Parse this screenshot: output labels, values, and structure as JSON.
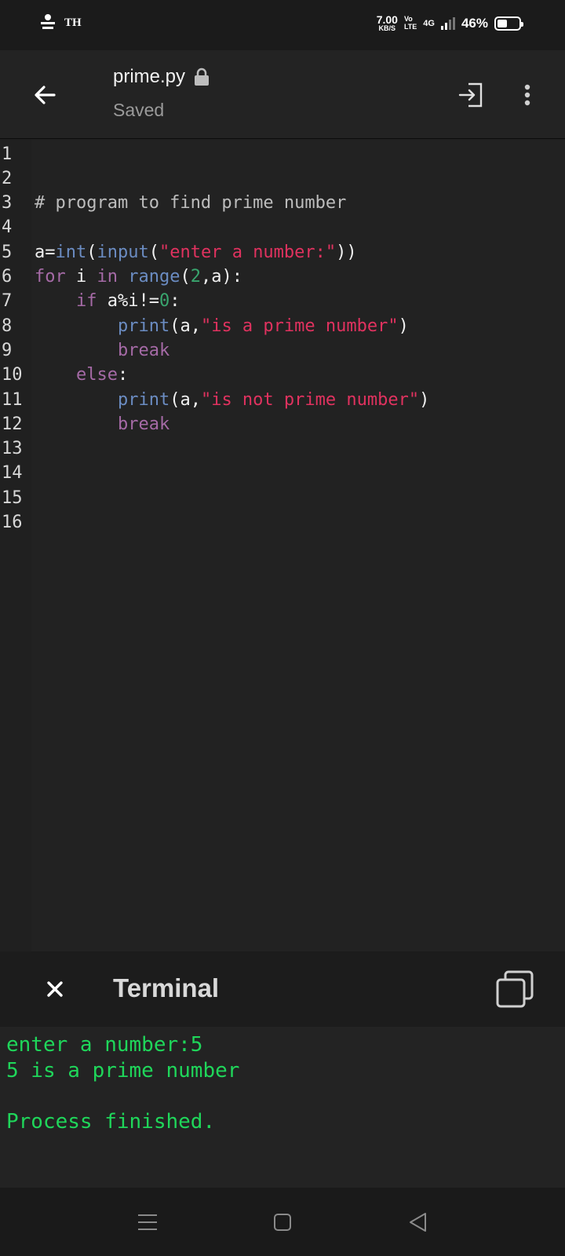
{
  "status_bar": {
    "carrier_text": "TH",
    "speed_value": "7.00",
    "speed_unit": "KB/S",
    "volte_top": "Vo",
    "volte_bottom": "LTE",
    "network": "4G",
    "battery_percent": "46%",
    "battery_level": 0.46
  },
  "app_bar": {
    "file_name": "prime.py",
    "file_status": "Saved",
    "icons": [
      "back-arrow-icon",
      "lock-icon",
      "run-icon",
      "more-vertical-icon"
    ]
  },
  "editor": {
    "line_numbers": [
      "1",
      "2",
      "3",
      "4",
      "5",
      "6",
      "7",
      "8",
      "9",
      "10",
      "11",
      "12",
      "13",
      "14",
      "15",
      "16"
    ],
    "lines": [
      [],
      [],
      [
        {
          "t": "# program to find prime number",
          "c": "comment"
        }
      ],
      [],
      [
        {
          "t": "a=",
          "c": "plain"
        },
        {
          "t": "int",
          "c": "fn"
        },
        {
          "t": "(",
          "c": "plain"
        },
        {
          "t": "input",
          "c": "fn"
        },
        {
          "t": "(",
          "c": "plain"
        },
        {
          "t": "\"enter a number:\"",
          "c": "str"
        },
        {
          "t": "))",
          "c": "plain"
        }
      ],
      [
        {
          "t": "for",
          "c": "kw"
        },
        {
          "t": " i ",
          "c": "plain"
        },
        {
          "t": "in",
          "c": "kw"
        },
        {
          "t": " ",
          "c": "plain"
        },
        {
          "t": "range",
          "c": "fn"
        },
        {
          "t": "(",
          "c": "plain"
        },
        {
          "t": "2",
          "c": "num"
        },
        {
          "t": ",a):",
          "c": "plain"
        }
      ],
      [
        {
          "t": "    ",
          "c": "plain"
        },
        {
          "t": "if",
          "c": "kw"
        },
        {
          "t": " a%i!=",
          "c": "plain"
        },
        {
          "t": "0",
          "c": "num"
        },
        {
          "t": ":",
          "c": "plain"
        }
      ],
      [
        {
          "t": "        ",
          "c": "plain"
        },
        {
          "t": "print",
          "c": "fn"
        },
        {
          "t": "(a,",
          "c": "plain"
        },
        {
          "t": "\"is a prime number\"",
          "c": "str"
        },
        {
          "t": ")",
          "c": "plain"
        }
      ],
      [
        {
          "t": "        ",
          "c": "plain"
        },
        {
          "t": "break",
          "c": "kw"
        }
      ],
      [
        {
          "t": "    ",
          "c": "plain"
        },
        {
          "t": "else",
          "c": "kw"
        },
        {
          "t": ":",
          "c": "plain"
        }
      ],
      [
        {
          "t": "        ",
          "c": "plain"
        },
        {
          "t": "print",
          "c": "fn"
        },
        {
          "t": "(a,",
          "c": "plain"
        },
        {
          "t": "\"is not prime number\"",
          "c": "str"
        },
        {
          "t": ")",
          "c": "plain"
        }
      ],
      [
        {
          "t": "        ",
          "c": "plain"
        },
        {
          "t": "break",
          "c": "kw"
        }
      ],
      [],
      [],
      [],
      []
    ]
  },
  "terminal": {
    "title": "Terminal",
    "output": [
      "enter a number:5",
      "5 is a prime number",
      "",
      "Process finished."
    ],
    "icons": [
      "close-icon",
      "copy-icon"
    ]
  },
  "nav_bar": {
    "icons": [
      "menu-icon",
      "home-icon",
      "back-icon"
    ]
  },
  "colors": {
    "comment": "#bdbdbd",
    "keyword": "#a56aa6",
    "function": "#6b8cc2",
    "string": "#e0325f",
    "number": "#39a56e",
    "terminal_text": "#1fd65a"
  }
}
